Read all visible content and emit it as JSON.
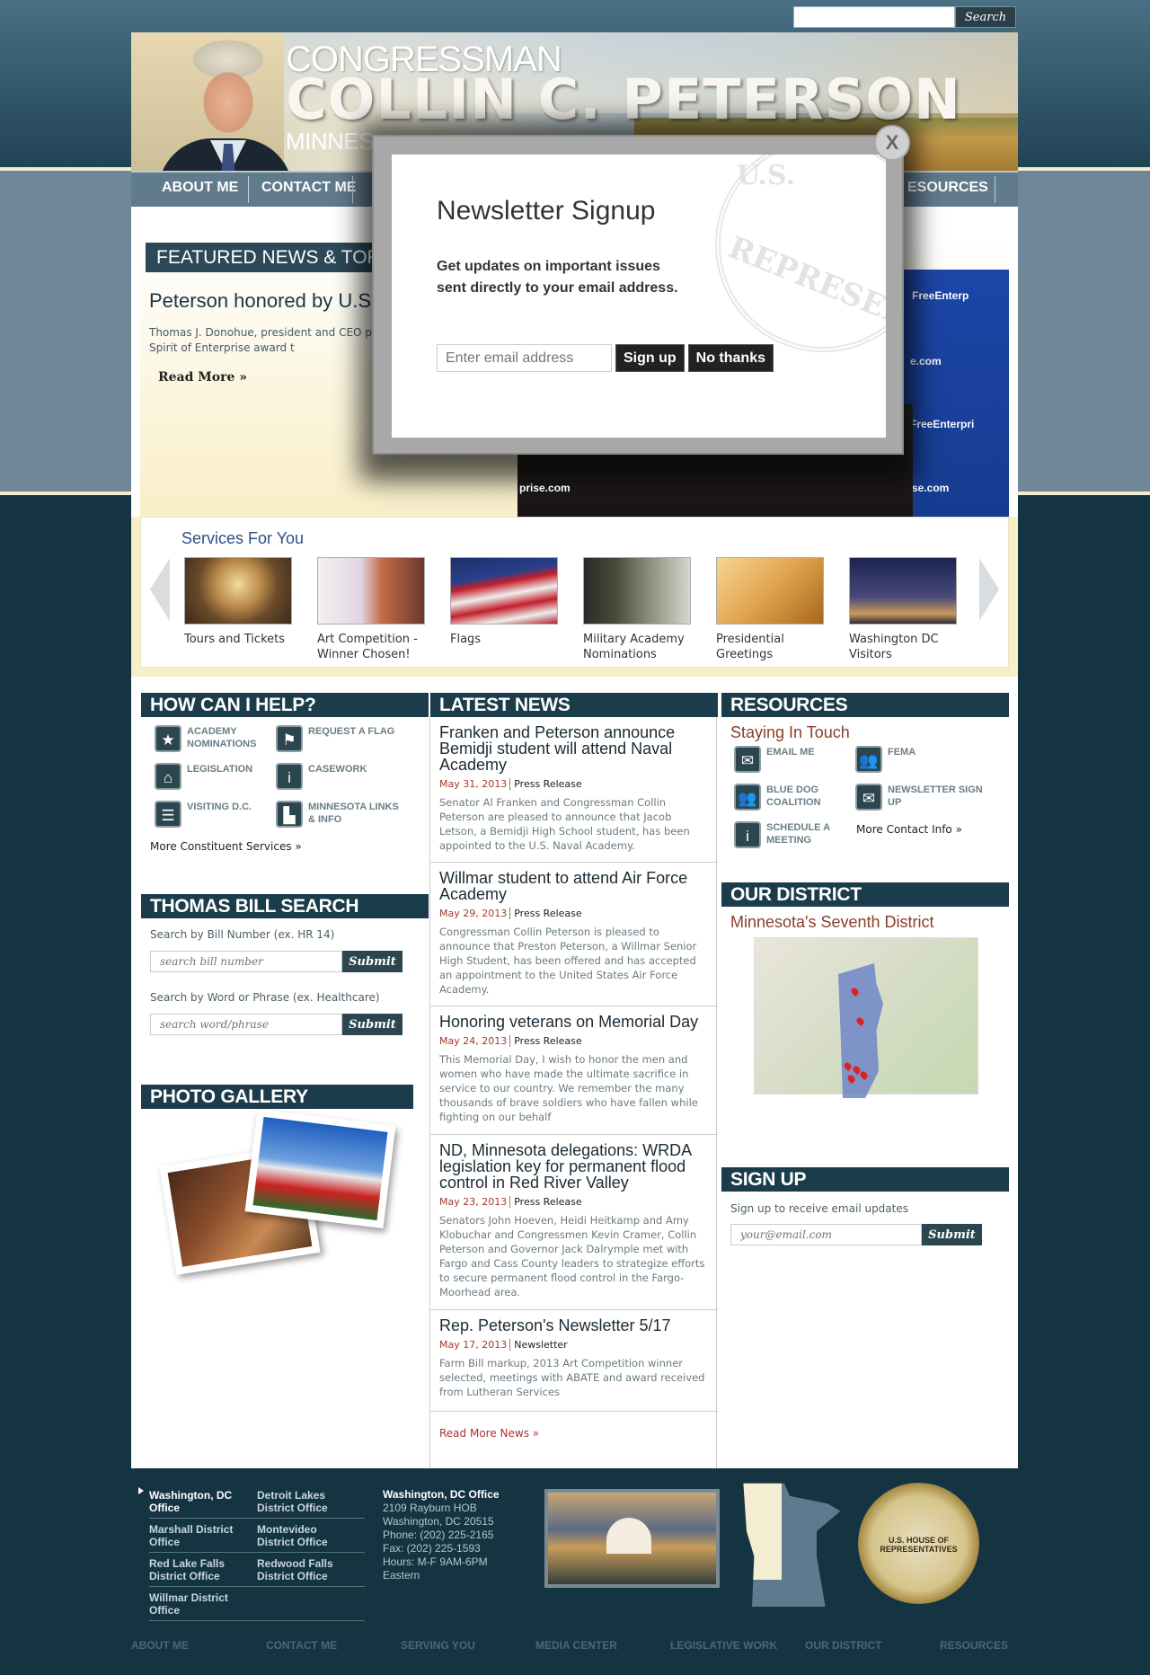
{
  "search": {
    "placeholder": "",
    "button_label": "Search"
  },
  "banner": {
    "line1": "CONGRESSMAN",
    "line2": "COLLIN C. PETERSON",
    "line3": "MINNES"
  },
  "nav": {
    "items": [
      "ABOUT ME",
      "CONTACT ME",
      "ESOURCES"
    ]
  },
  "featured": {
    "heading": "FEATURED NEWS & TOPIC",
    "title": "Peterson honored by U.S",
    "text": "Thomas J. Donohue, president and CEO presents the Spirit of Enterprise award t",
    "read_more": "Read More »",
    "photo_texts": [
      "FreeEnterp",
      "e.com",
      "FreeEnterpri",
      "prise.com",
      "se.com"
    ]
  },
  "services": {
    "title": "Services For You",
    "items": [
      {
        "label": "Tours and Tickets"
      },
      {
        "label": "Art Competition - Winner Chosen!"
      },
      {
        "label": "Flags"
      },
      {
        "label": "Military Academy Nominations"
      },
      {
        "label": "Presidential Greetings"
      },
      {
        "label": "Washington DC Visitors"
      }
    ]
  },
  "help": {
    "heading": "HOW CAN I HELP?",
    "items": [
      "ACADEMY NOMINATIONS",
      "REQUEST A FLAG",
      "LEGISLATION",
      "CASEWORK",
      "VISITING D.C.",
      "MINNESOTA LINKS & INFO"
    ],
    "more": "More Constituent Services »"
  },
  "thomas": {
    "heading": "THOMAS BILL SEARCH",
    "label1": "Search by Bill Number (ex. HR 14)",
    "placeholder1": "search bill number",
    "label2": "Search by Word or Phrase (ex. Healthcare)",
    "placeholder2": "search word/phrase",
    "submit": "Submit"
  },
  "gallery": {
    "heading": "PHOTO GALLERY"
  },
  "news": {
    "heading": "LATEST NEWS",
    "items": [
      {
        "title": "Franken and Peterson announce Bemidji student will attend Naval Academy",
        "date": "May 31, 2013",
        "category": "Press Release",
        "desc": "Senator Al Franken and Congressman Collin Peterson are pleased to announce that Jacob Letson, a Bemidji High School student, has been appointed to the U.S. Naval Academy."
      },
      {
        "title": "Willmar student to attend Air Force Academy",
        "date": "May 29, 2013",
        "category": "Press Release",
        "desc": "Congressman Collin Peterson is pleased to announce that Preston Peterson, a Willmar Senior High Student, has been offered and has accepted an appointment to the United States Air Force Academy."
      },
      {
        "title": "Honoring veterans on Memorial Day",
        "date": "May 24, 2013",
        "category": "Press Release",
        "desc": "This Memorial Day, I wish to honor the men and women who have made the ultimate sacrifice in service to our country. We remember the many thousands of brave soldiers who have fallen while fighting on our behalf"
      },
      {
        "title": "ND, Minnesota delegations: WRDA legislation key for permanent flood control in Red River Valley",
        "date": "May 23, 2013",
        "category": "Press Release",
        "desc": "Senators John Hoeven, Heidi Heitkamp and Amy Klobuchar and Congressmen Kevin Cramer, Collin Peterson and Governor Jack Dalrymple met with Fargo and Cass County leaders to strategize efforts to secure permanent flood control in the Fargo-Moorhead area."
      },
      {
        "title": "Rep. Peterson's Newsletter 5/17",
        "date": "May 17, 2013",
        "category": "Newsletter",
        "desc": "Farm Bill markup, 2013 Art Competition winner selected, meetings with ABATE and award received from Lutheran Services"
      }
    ],
    "more": "Read More News »"
  },
  "resources": {
    "heading": "RESOURCES",
    "subtitle": "Staying In Touch",
    "items": [
      "EMAIL ME",
      "FEMA",
      "BLUE DOG COALITION",
      "NEWSLETTER SIGN UP",
      "SCHEDULE A MEETING"
    ],
    "more": "More Contact Info »"
  },
  "district": {
    "heading": "OUR DISTRICT",
    "subtitle": "Minnesota's Seventh District"
  },
  "signup": {
    "heading": "SIGN UP",
    "label": "Sign up to receive email updates",
    "placeholder": "your@email.com",
    "submit": "Submit"
  },
  "footer": {
    "offices": [
      "Washington, DC Office",
      "Detroit Lakes District Office",
      "Marshall District Office",
      "Montevideo District Office",
      "Red Lake Falls District Office",
      "Redwood Falls District Office",
      "Willmar District Office"
    ],
    "address": [
      "Washington, DC Office",
      "2109 Rayburn HOB",
      "Washington, DC 20515",
      "Phone: (202) 225-2165",
      "Fax: (202) 225-1593",
      "Hours: M-F 9AM-6PM",
      "Eastern"
    ],
    "seal_text": "U.S. HOUSE OF REPRESENTATIVES",
    "nav": [
      "ABOUT ME",
      "CONTACT ME",
      "SERVING YOU",
      "MEDIA CENTER",
      "LEGISLATIVE WORK",
      "OUR DISTRICT",
      "RESOURCES"
    ]
  },
  "modal": {
    "title": "Newsletter Signup",
    "text": "Get updates on important issues sent directly to your email address.",
    "placeholder": "Enter email address",
    "signup": "Sign up",
    "no_thanks": "No thanks",
    "close": "X",
    "seal_text": [
      "U.S.",
      "REPRESENTAT"
    ]
  }
}
